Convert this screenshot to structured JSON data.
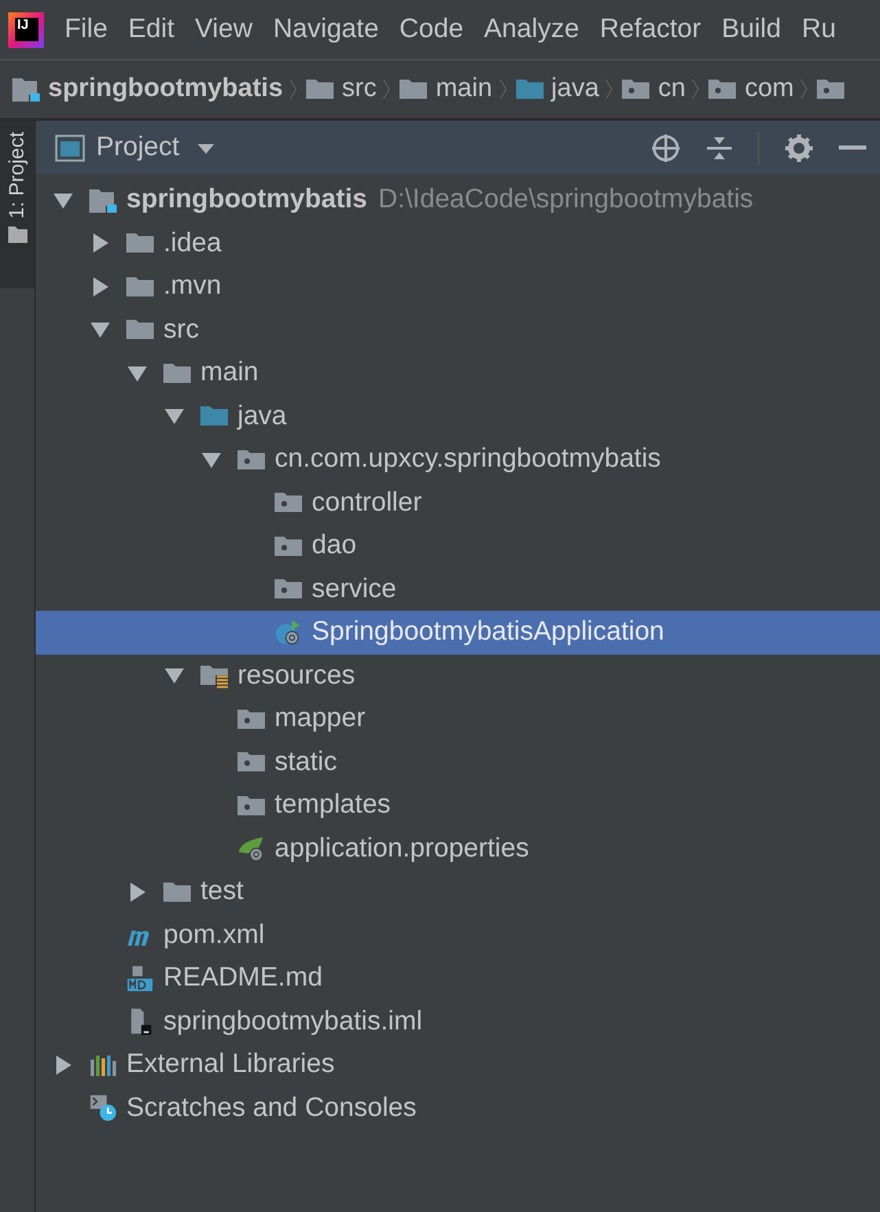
{
  "app_logo": "IJ",
  "menu": [
    "File",
    "Edit",
    "View",
    "Navigate",
    "Code",
    "Analyze",
    "Refactor",
    "Build",
    "Ru"
  ],
  "breadcrumb": [
    {
      "label": "springbootmybatis",
      "kind": "module"
    },
    {
      "label": "src",
      "kind": "folder"
    },
    {
      "label": "main",
      "kind": "folder"
    },
    {
      "label": "java",
      "kind": "source"
    },
    {
      "label": "cn",
      "kind": "package"
    },
    {
      "label": "com",
      "kind": "package"
    },
    {
      "kind": "package"
    }
  ],
  "side_tab": {
    "label": "1: Project",
    "selected": true
  },
  "panel": {
    "title": "Project"
  },
  "tree": [
    {
      "label": "springbootmybatis",
      "kind": "module",
      "hint": "D:\\IdeaCode\\springbootmybatis",
      "expanded": true,
      "selected": false,
      "children": [
        {
          "label": ".idea",
          "kind": "folder",
          "expanded": false,
          "selected": false
        },
        {
          "label": ".mvn",
          "kind": "folder",
          "expanded": false,
          "selected": false
        },
        {
          "label": "src",
          "kind": "folder",
          "expanded": true,
          "selected": false,
          "children": [
            {
              "label": "main",
              "kind": "folder",
              "expanded": true,
              "selected": false,
              "children": [
                {
                  "label": "java",
                  "kind": "source",
                  "expanded": true,
                  "selected": false,
                  "children": [
                    {
                      "label": "cn.com.upxcy.springbootmybatis",
                      "kind": "package",
                      "expanded": true,
                      "selected": false,
                      "children": [
                        {
                          "label": "controller",
                          "kind": "package",
                          "selected": false
                        },
                        {
                          "label": "dao",
                          "kind": "package",
                          "selected": false
                        },
                        {
                          "label": "service",
                          "kind": "package",
                          "selected": false
                        },
                        {
                          "label": "SpringbootmybatisApplication",
                          "kind": "spring-class",
                          "selected": true
                        }
                      ]
                    }
                  ]
                },
                {
                  "label": "resources",
                  "kind": "resources",
                  "expanded": true,
                  "selected": false,
                  "children": [
                    {
                      "label": "mapper",
                      "kind": "package",
                      "selected": false
                    },
                    {
                      "label": "static",
                      "kind": "package",
                      "selected": false
                    },
                    {
                      "label": "templates",
                      "kind": "package",
                      "selected": false
                    },
                    {
                      "label": "application.properties",
                      "kind": "spring-props",
                      "selected": false
                    }
                  ]
                }
              ]
            },
            {
              "label": "test",
              "kind": "folder",
              "expanded": false,
              "selected": false
            }
          ]
        },
        {
          "label": "pom.xml",
          "kind": "maven",
          "selected": false
        },
        {
          "label": "README.md",
          "kind": "markdown",
          "selected": false
        },
        {
          "label": "springbootmybatis.iml",
          "kind": "iml",
          "selected": false
        }
      ]
    },
    {
      "label": "External Libraries",
      "kind": "libraries",
      "expanded": false,
      "selected": false
    },
    {
      "label": "Scratches and Consoles",
      "kind": "scratches",
      "selected": false
    }
  ]
}
